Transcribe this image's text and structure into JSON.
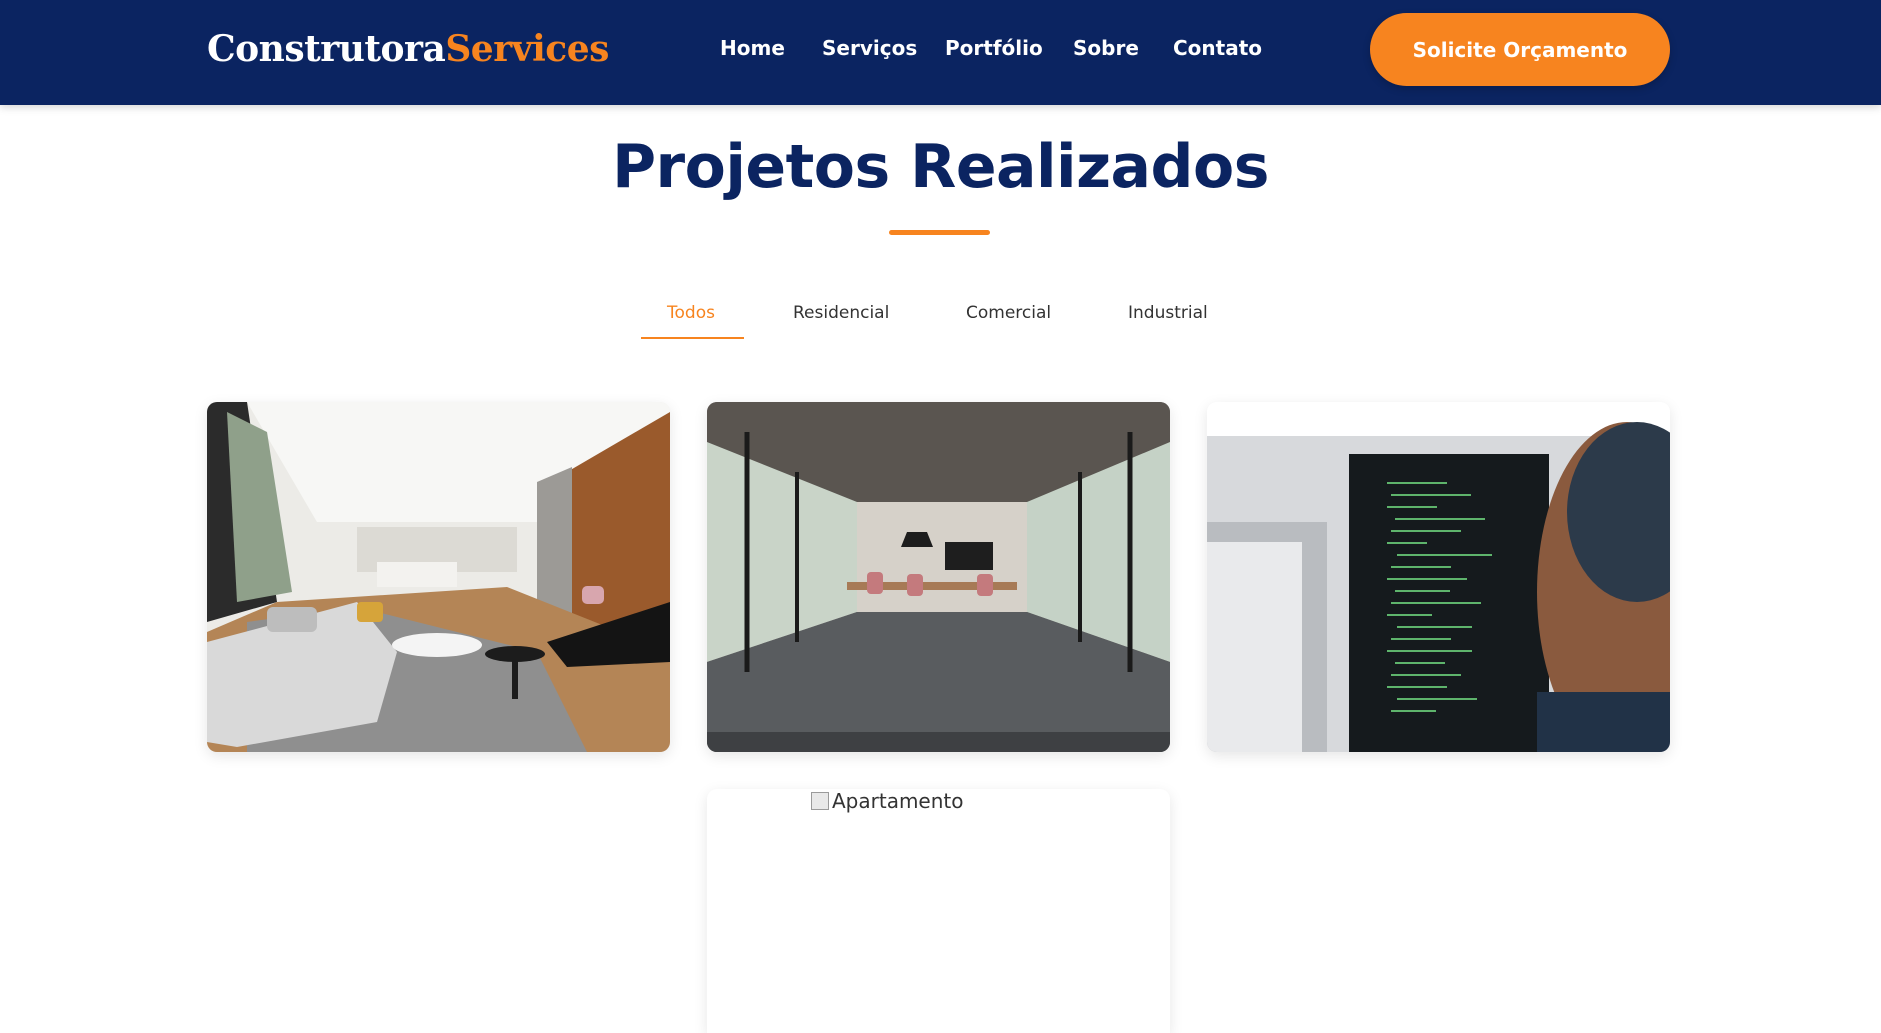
{
  "header": {
    "logo": {
      "part1": "Construtora",
      "part2": "Services"
    },
    "nav": [
      {
        "label": "Home"
      },
      {
        "label": "Serviços"
      },
      {
        "label": "Portfólio"
      },
      {
        "label": "Sobre"
      },
      {
        "label": "Contato"
      }
    ],
    "cta_label": "Solicite Orçamento"
  },
  "portfolio": {
    "title": "Projetos Realizados",
    "filters": [
      {
        "label": "Todos",
        "active": true
      },
      {
        "label": "Residencial",
        "active": false
      },
      {
        "label": "Comercial",
        "active": false
      },
      {
        "label": "Industrial",
        "active": false
      }
    ],
    "cards": [
      {
        "image": "living-room-photo"
      },
      {
        "image": "office-meeting-room-photo"
      },
      {
        "image": "code-monitor-photo"
      },
      {
        "image": "broken-image",
        "alt": "Apartamento"
      }
    ]
  },
  "colors": {
    "navy": "#0b2461",
    "orange": "#f7841f"
  }
}
